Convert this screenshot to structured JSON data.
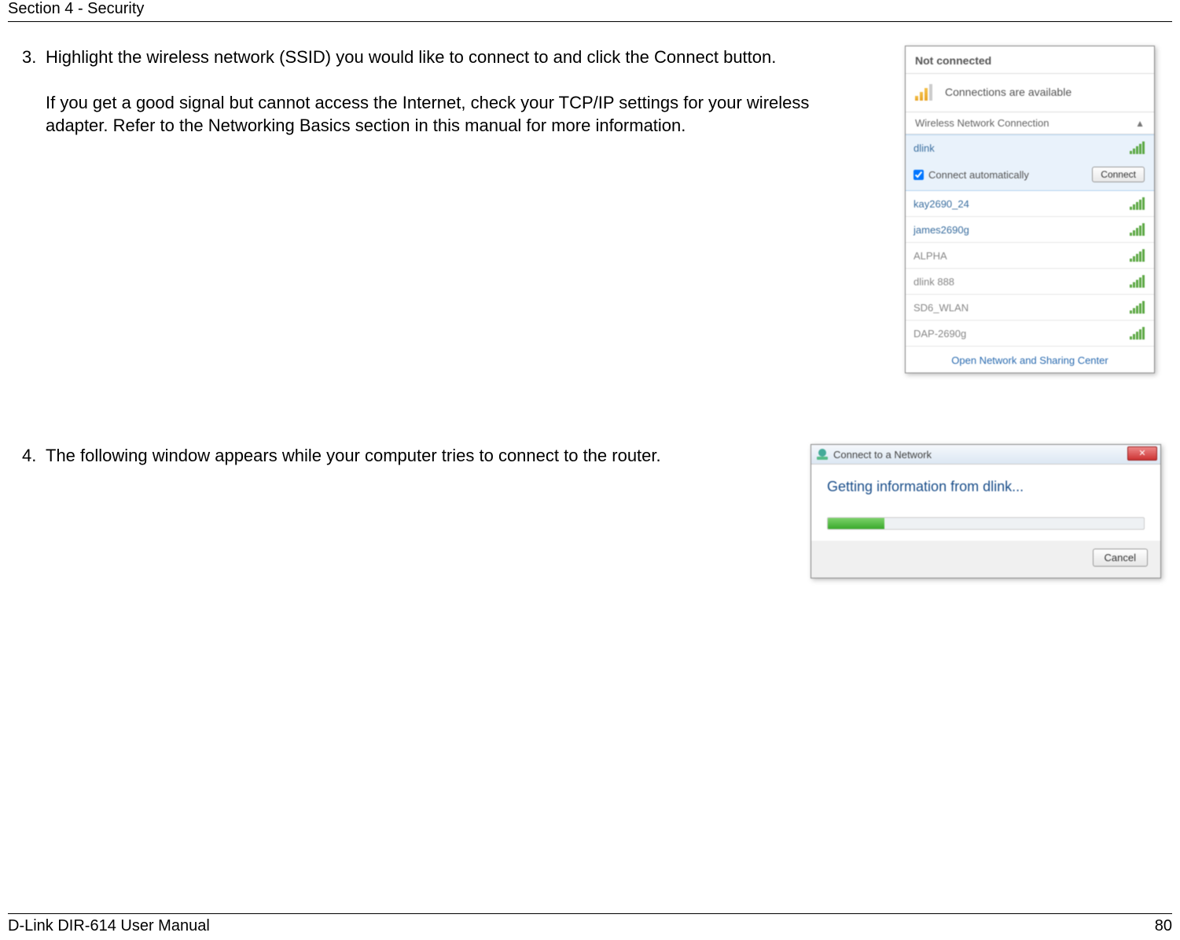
{
  "header": {
    "section": "Section 4 - Security"
  },
  "steps": {
    "item3": {
      "num": "3.",
      "p1": "Highlight the wireless network (SSID) you would like to connect to and click the Connect button.",
      "p2": "If you get a good signal but cannot access the Internet, check your TCP/IP settings for your wireless adapter. Refer to the Networking Basics section in this manual for more information."
    },
    "item4": {
      "num": "4.",
      "p1": "The following window appears while your computer tries to connect to the router."
    }
  },
  "wifi_popup": {
    "status": "Not connected",
    "available": "Connections are available",
    "section_header": "Wireless Network Connection",
    "selected_network": "dlink",
    "auto_connect_label": "Connect automatically",
    "connect_button": "Connect",
    "networks": [
      "kay2690_24",
      "james2690g",
      "ALPHA",
      "dlink 888",
      "SD6_WLAN",
      "DAP-2690g"
    ],
    "footer_link": "Open Network and Sharing Center"
  },
  "connect_dialog": {
    "title": "Connect to a Network",
    "message": "Getting information from dlink...",
    "cancel": "Cancel",
    "close": "✕"
  },
  "footer": {
    "manual": "D-Link DIR-614 User Manual",
    "page": "80"
  }
}
